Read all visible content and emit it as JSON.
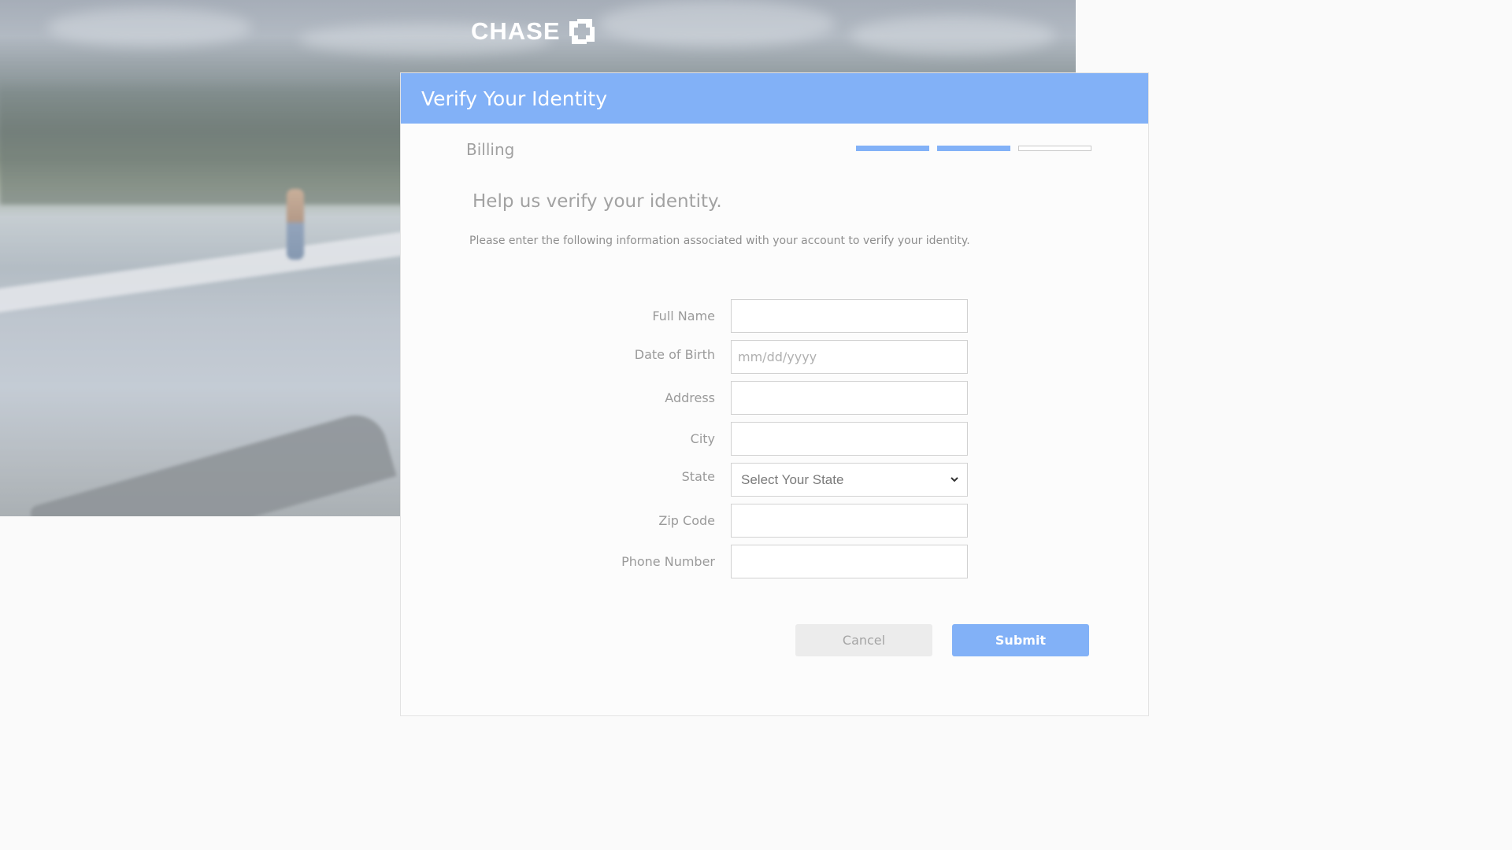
{
  "brand": {
    "logo_text": "CHASE",
    "logo_icon": "chase-octagon-icon",
    "accent": "#82b1f7"
  },
  "header": {
    "title": "Verify Your Identity"
  },
  "step": {
    "label": "Billing",
    "progress": {
      "completed": 2,
      "total": 3
    }
  },
  "intro": {
    "title": "Help us verify your identity.",
    "text": "Please enter the following information associated with your account to verify your identity."
  },
  "form": {
    "full_name": {
      "label": "Full Name",
      "value": "",
      "placeholder": ""
    },
    "dob": {
      "label": "Date of Birth",
      "value": "",
      "placeholder": "mm/dd/yyyy"
    },
    "address": {
      "label": "Address",
      "value": "",
      "placeholder": ""
    },
    "city": {
      "label": "City",
      "value": "",
      "placeholder": ""
    },
    "state": {
      "label": "State",
      "selected": "Select Your State"
    },
    "zip": {
      "label": "Zip Code",
      "value": "",
      "placeholder": ""
    },
    "phone": {
      "label": "Phone Number",
      "value": "",
      "placeholder": ""
    }
  },
  "actions": {
    "cancel_label": "Cancel",
    "submit_label": "Submit"
  }
}
